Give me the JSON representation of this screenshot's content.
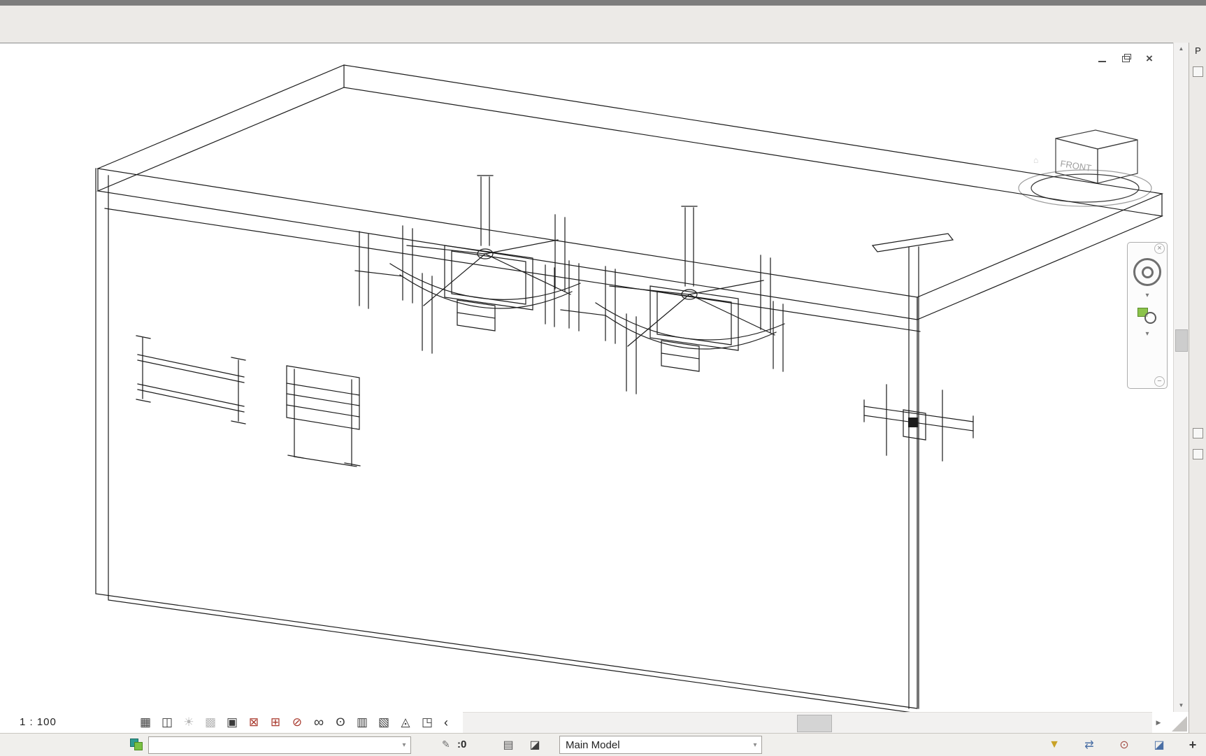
{
  "viewcube": {
    "front_label": "FRONT",
    "home_glyph": "⌂"
  },
  "window_controls": {
    "close_glyph": "×"
  },
  "navigation_bar": {
    "close_glyph": "×",
    "wheel_caret_glyph": "▾",
    "zoom_caret_glyph": "▾",
    "collapse_glyph": "−"
  },
  "scrollbars": {
    "up_glyph": "▲",
    "down_glyph": "▼",
    "right_glyph": "▶"
  },
  "view_control_bar": {
    "scale_label": "1 : 100",
    "collapse_glyph": "‹",
    "icons": [
      {
        "name": "visual-style-icon",
        "glyph": "▦"
      },
      {
        "name": "detail-level-icon",
        "glyph": "◫"
      },
      {
        "name": "sun-path-icon",
        "glyph": "☀"
      },
      {
        "name": "shadows-icon",
        "glyph": "▩"
      },
      {
        "name": "rendering-dialog-icon",
        "glyph": "▣"
      },
      {
        "name": "crop-view-icon",
        "glyph": "⊠"
      },
      {
        "name": "show-crop-region-icon",
        "glyph": "⊞"
      },
      {
        "name": "lock-3d-view-icon",
        "glyph": "⊘"
      },
      {
        "name": "temporary-hide-isolate-icon",
        "glyph": "∞"
      },
      {
        "name": "reveal-hidden-elements-icon",
        "glyph": "ʘ"
      },
      {
        "name": "worksharing-display-icon",
        "glyph": "▥"
      },
      {
        "name": "temporary-view-properties-icon",
        "glyph": "▧"
      },
      {
        "name": "analytical-model-icon",
        "glyph": "◬"
      },
      {
        "name": "displacement-sets-icon",
        "glyph": "◳"
      }
    ]
  },
  "status_bar": {
    "workset_value": "",
    "workset_dropdown_glyph": "▾",
    "editing_requests_glyph": "✎",
    "editing_requests_value": ":0",
    "worksets_dialog_glyph": "▤",
    "design_options_glyph": "◪",
    "design_option_value": "Main Model",
    "design_option_dropdown_glyph": "▾",
    "right_icons": [
      {
        "name": "filter-icon",
        "glyph": "▼"
      },
      {
        "name": "select-links-icon",
        "glyph": "⇄"
      },
      {
        "name": "select-pinned-icon",
        "glyph": "⊙"
      },
      {
        "name": "select-by-face-icon",
        "glyph": "◪"
      },
      {
        "name": "drag-on-selection-icon",
        "glyph": "+"
      }
    ]
  },
  "side_panel": {
    "label": "P"
  }
}
